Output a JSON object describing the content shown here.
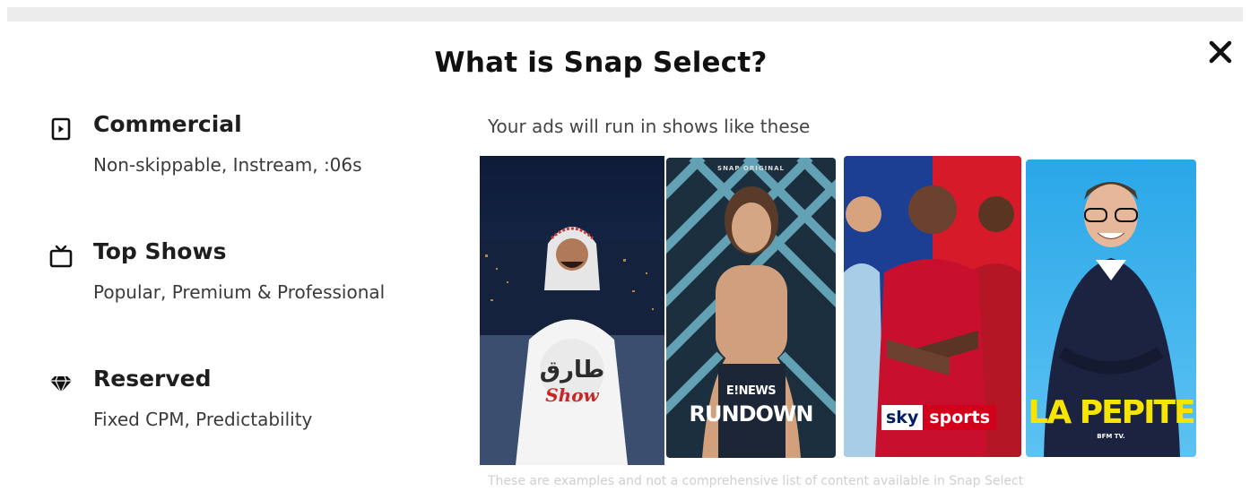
{
  "modal": {
    "title": "What is Snap Select?",
    "close_icon": "close-icon"
  },
  "features": [
    {
      "icon": "play-square-icon",
      "name": "Commercial",
      "description": "Non-skippable, Instream, :06s"
    },
    {
      "icon": "tv-icon",
      "name": "Top Shows",
      "description": "Popular, Premium & Professional"
    },
    {
      "icon": "diamond-icon",
      "name": "Reserved",
      "description": "Fixed CPM, Predictability"
    }
  ],
  "shows_heading": "Your ads will run in shows like these",
  "shows": [
    {
      "logo_line1": "طارق",
      "logo_line2": "Show"
    },
    {
      "logo_top": "SNAP ORIGINAL",
      "logo_line1": "E!NEWS",
      "logo_line2": "RUNDOWN"
    },
    {
      "logo_line1": "sky",
      "logo_line2": "sports"
    },
    {
      "logo_line1": "LA PEPITE",
      "logo_line2": "BFM TV."
    }
  ],
  "disclaimer": "These are examples and not a comprehensive list of content available in Snap Select",
  "colors": {
    "sky_red": "#d3001b",
    "sky_blue": "#001e62",
    "pepite_yellow": "#f7e500",
    "pepite_bg": "#2aa7e8"
  }
}
